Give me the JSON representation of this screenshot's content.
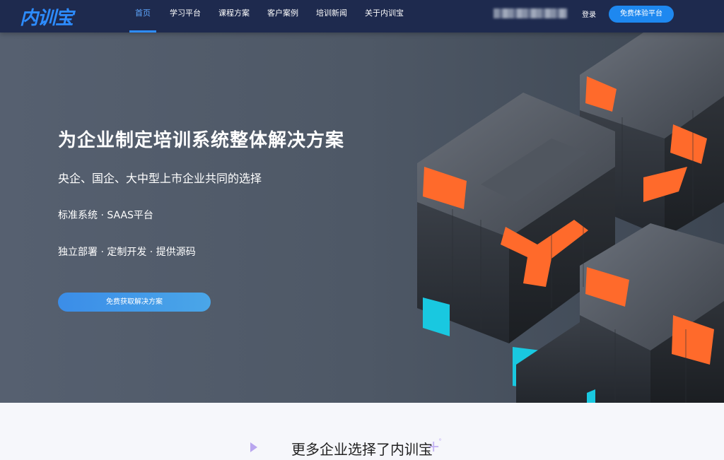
{
  "brand": {
    "logo_text": "内训宝"
  },
  "nav": {
    "items": [
      {
        "label": "首页",
        "active": true
      },
      {
        "label": "学习平台",
        "active": false
      },
      {
        "label": "课程方案",
        "active": false
      },
      {
        "label": "客户案例",
        "active": false
      },
      {
        "label": "培训新闻",
        "active": false
      },
      {
        "label": "关于内训宝",
        "active": false
      }
    ],
    "login_label": "登录",
    "trial_button": "免费体验平台"
  },
  "hero": {
    "title": "为企业制定培训系统整体解决方案",
    "subtitle": "央企、国企、大中型上市企业共同的选择",
    "line1": "标准系统 · SAAS平台",
    "line2": "独立部署 · 定制开发 · 提供源码",
    "cta_label": "免费获取解决方案"
  },
  "section": {
    "title": "更多企业选择了内训宝"
  },
  "colors": {
    "nav_bg": "#1e2a4e",
    "accent": "#2d8cff",
    "hero_bg": "#525c6a",
    "cube_orange": "#ff6a2b",
    "cube_cyan": "#19c8e0"
  }
}
